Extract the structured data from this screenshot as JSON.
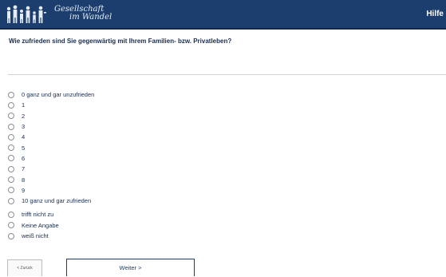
{
  "header": {
    "logo_line1": "Gesellschaft",
    "logo_line2": "im Wandel",
    "help_label": "Hilfe",
    "bg_color": "#1b3e6e"
  },
  "question": {
    "text": "Wie zufrieden sind Sie gegenwärtig mit Ihrem Familien- bzw. Privatleben?"
  },
  "scale_options": [
    "0 ganz und gar unzufrieden",
    "1",
    "2",
    "3",
    "4",
    "5",
    "6",
    "7",
    "8",
    "9",
    "10 ganz und gar zufrieden"
  ],
  "extra_options": [
    "trifft nicht zu",
    "Keine Angabe",
    "weiß nicht"
  ],
  "nav": {
    "back_label": "< Zurück",
    "next_label": "Weiter >"
  }
}
